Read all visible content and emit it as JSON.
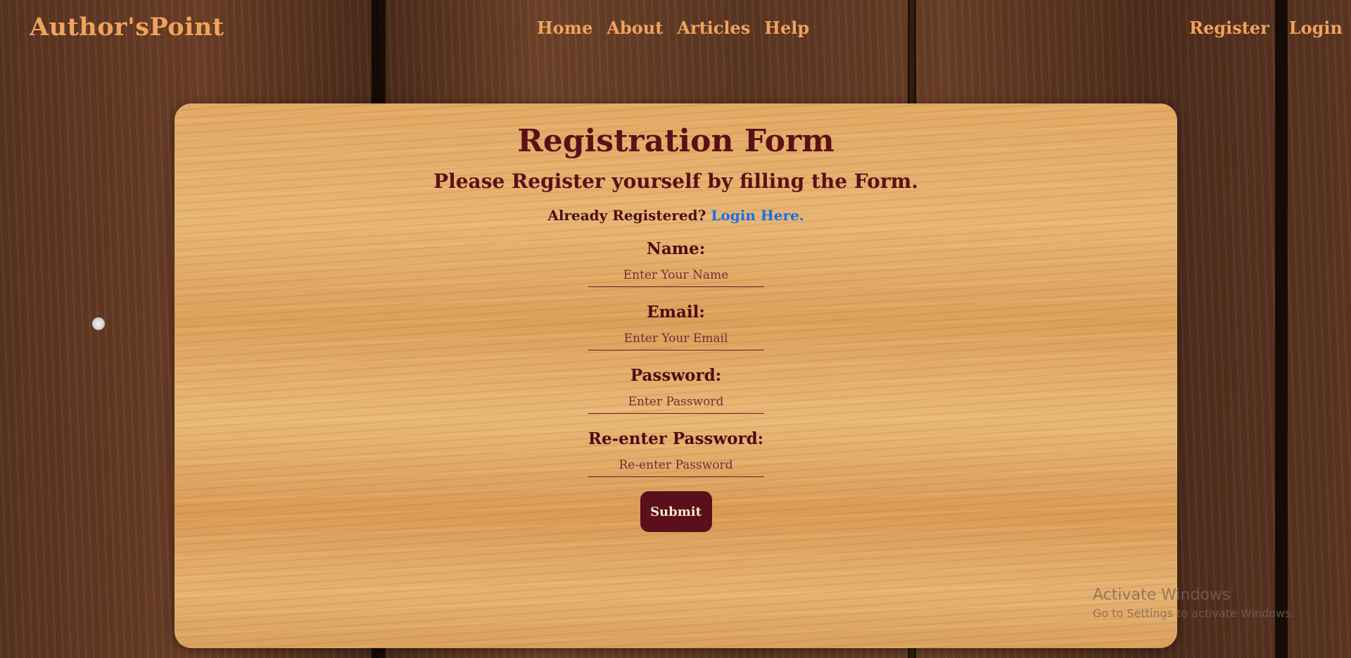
{
  "navbar": {
    "brand": "Author'sPoint",
    "links": [
      {
        "label": "Home"
      },
      {
        "label": "About"
      },
      {
        "label": "Articles"
      },
      {
        "label": "Help"
      }
    ],
    "auth_links": [
      {
        "label": "Register"
      },
      {
        "label": "Login"
      }
    ]
  },
  "form": {
    "title": "Registration Form",
    "subtitle": "Please Register yourself by filling the Form.",
    "login_prompt": "Already Registered?",
    "login_link": "Login Here.",
    "fields": [
      {
        "label": "Name:",
        "placeholder": "Enter Your Name",
        "value": ""
      },
      {
        "label": "Email:",
        "placeholder": "Enter Your Email",
        "value": ""
      },
      {
        "label": "Password:",
        "placeholder": "Enter Password",
        "value": ""
      },
      {
        "label": "Re-enter Password:",
        "placeholder": "Re-enter Password",
        "value": ""
      }
    ],
    "submit_label": "Submit"
  },
  "watermark": {
    "title": "Activate Windows",
    "subtitle": "Go to Settings to activate Windows."
  },
  "colors": {
    "brand": "#f0a35c",
    "heading": "#5b1017",
    "link": "#1a6fe0",
    "button_bg": "#5a0f1a",
    "button_text": "#ffe9c7"
  }
}
